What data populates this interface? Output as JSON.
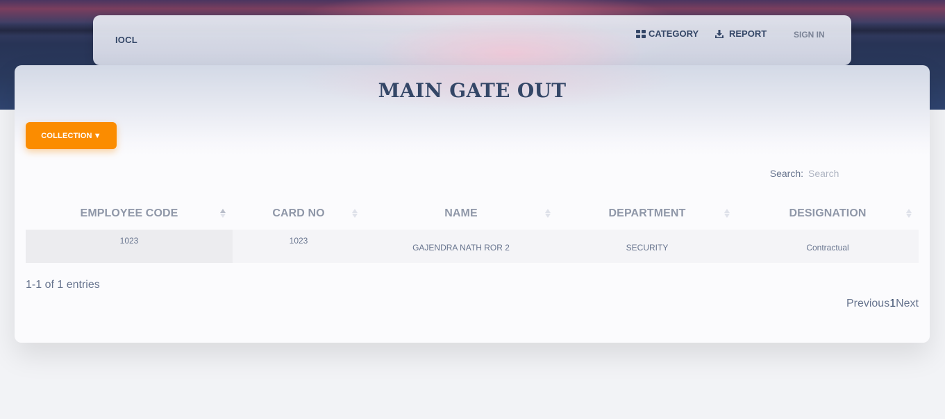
{
  "navbar": {
    "brand": "IOCL",
    "category_label": "CATEGORY",
    "report_label": "REPORT",
    "signin_label": "SIGN IN"
  },
  "page": {
    "title": "MAIN GATE OUT",
    "collection_label": "COLLECTION",
    "collection_caret": "▼"
  },
  "search": {
    "label": "Search:",
    "placeholder": "Search",
    "value": ""
  },
  "table": {
    "columns": [
      "EMPLOYEE CODE",
      "CARD NO",
      "NAME",
      "DEPARTMENT",
      "DESIGNATION"
    ],
    "sorted_column": "EMPLOYEE CODE",
    "rows": [
      {
        "employee_code": "1023",
        "card_no": "1023",
        "name": "GAJENDRA NATH ROR 2",
        "department": "SECURITY",
        "designation": "Contractual"
      }
    ]
  },
  "footer": {
    "entries_text": "1-1 of 1 entries",
    "previous_label": "Previous",
    "current_page": "1",
    "next_label": "Next"
  },
  "colors": {
    "accent_orange": "#fb8c00",
    "heading": "#344767",
    "muted_text": "#67748e"
  },
  "icons": {
    "category": "grid-icon",
    "report": "download-icon",
    "sort": "sort-arrows-icon"
  }
}
